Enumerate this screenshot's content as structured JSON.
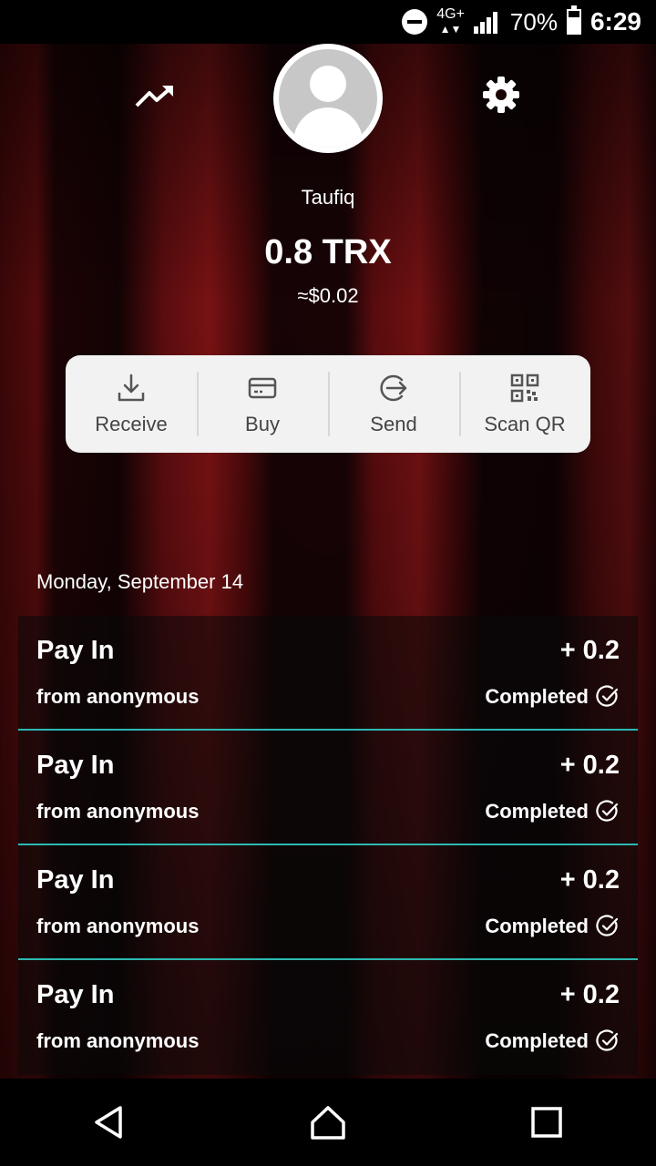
{
  "status_bar": {
    "network": "4G+",
    "battery": "70%",
    "time": "6:29"
  },
  "profile": {
    "username": "Taufiq",
    "balance": "0.8 TRX",
    "fiat_balance": "≈$0.02"
  },
  "actions": [
    {
      "label": "Receive",
      "icon": "download-icon"
    },
    {
      "label": "Buy",
      "icon": "card-icon"
    },
    {
      "label": "Send",
      "icon": "send-icon"
    },
    {
      "label": "Scan QR",
      "icon": "qr-icon"
    }
  ],
  "transactions": {
    "date": "Monday, September 14",
    "items": [
      {
        "type": "Pay In",
        "amount": "+ 0.2",
        "from": "from anonymous",
        "status": "Completed"
      },
      {
        "type": "Pay In",
        "amount": "+ 0.2",
        "from": "from anonymous",
        "status": "Completed"
      },
      {
        "type": "Pay In",
        "amount": "+ 0.2",
        "from": "from anonymous",
        "status": "Completed"
      },
      {
        "type": "Pay In",
        "amount": "+ 0.2",
        "from": "from anonymous",
        "status": "Completed"
      }
    ]
  },
  "colors": {
    "accent_divider": "#2cb9b1",
    "card_bg": "#f2f2f2"
  }
}
